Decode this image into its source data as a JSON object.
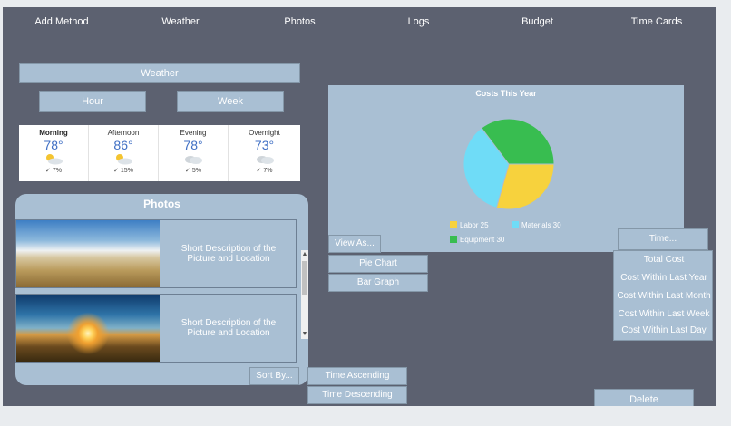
{
  "nav": {
    "tabs": [
      {
        "label": "Add Method",
        "color": "#78b58f"
      },
      {
        "label": "Weather",
        "color": "#4b7c70"
      },
      {
        "label": "Photos",
        "color": "#78b58f"
      },
      {
        "label": "Logs",
        "color": "#4b7c70"
      },
      {
        "label": "Budget",
        "color": "#78b58f"
      },
      {
        "label": "Time Cards",
        "color": "#4b7c70"
      }
    ]
  },
  "weather": {
    "title": "Weather",
    "hour_button": "Hour",
    "week_button": "Week",
    "periods": [
      {
        "name": "Morning",
        "temp": "78°",
        "rain": "✓ 7%",
        "icon": "partly-sunny-icon"
      },
      {
        "name": "Afternoon",
        "temp": "86°",
        "rain": "✓ 15%",
        "icon": "partly-sunny-icon"
      },
      {
        "name": "Evening",
        "temp": "78°",
        "rain": "✓ 5%",
        "icon": "cloudy-icon"
      },
      {
        "name": "Overnight",
        "temp": "73°",
        "rain": "✓ 7%",
        "icon": "cloudy-icon"
      }
    ]
  },
  "photos": {
    "title": "Photos",
    "items": [
      {
        "description": "Short Description of the Picture and Location"
      },
      {
        "description": "Short Description of the Picture and Location"
      }
    ],
    "sort_button": "Sort By...",
    "sort_options": [
      "Time Ascending",
      "Time Descending"
    ]
  },
  "costs": {
    "view_as_button": "View As...",
    "view_options": [
      "Pie Chart",
      "Bar Graph"
    ],
    "time_button": "Time...",
    "time_options": [
      "Total Cost",
      "Cost Within Last Year",
      "Cost Within Last Month",
      "Cost Within Last Week",
      "Cost Within Last Day"
    ],
    "delete_button": "Delete"
  },
  "chart_data": {
    "type": "pie",
    "title": "Costs This Year",
    "slices": [
      {
        "label": "Labor",
        "value": 25,
        "color": "#f7d23d"
      },
      {
        "label": "Materials",
        "value": 30,
        "color": "#6fdcf7"
      },
      {
        "label": "Equipment",
        "value": 30,
        "color": "#38bd50"
      }
    ],
    "legend_position": "bottom"
  }
}
